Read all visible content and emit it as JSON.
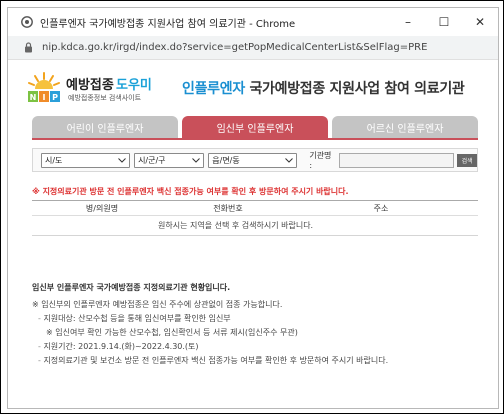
{
  "window": {
    "title": "인플루엔자 국가예방접종 지원사업 참여 의료기관 - Chrome",
    "url": "nip.kdca.go.kr/irgd/index.do?service=getPopMedicalCenterList&SelFlag=PRE",
    "minimize": "–",
    "maximize": "☐",
    "close": "✕"
  },
  "logo": {
    "brand_main": "예방접종",
    "brand_accent": "도우미",
    "sub": "예방접종정보 검색사이트",
    "letters": "NIP"
  },
  "header": {
    "title_accent": "인플루엔자",
    "title_rest": " 국가예방접종 지원사업 참여 의료기관"
  },
  "tabs": [
    {
      "label": "어린이 인플루엔자",
      "active": false
    },
    {
      "label": "임신부 인플루엔자",
      "active": true
    },
    {
      "label": "어르신 인플루엔자",
      "active": false
    }
  ],
  "filters": {
    "sido": "시/도",
    "sigungu": "시/군/구",
    "eupmyeondong": "읍/면/동",
    "org_label": "기관명 :",
    "org_value": "",
    "search_button": "검색"
  },
  "warning": "※ 지정의료기관 방문 전 인플루엔자 백신 접종가능 여부를 확인 후 방문하여 주시기 바랍니다.",
  "table": {
    "headers": [
      "병/의원명",
      "전화번호",
      "주소"
    ],
    "empty_message": "원하시는 지역을 선택 후 검색하시기 바랍니다."
  },
  "guide": {
    "title": "임신부 인플루엔자 국가예방접종 지정의료기관 현황입니다.",
    "lines": [
      "※ 임신부의 인플루엔자 예방접종은 임신 주수에 상관없이 접종 가능합니다.",
      "지원대상: 산모수첩 등을 통해 임신여부를 확인한 임신부",
      "※ 임신여부 확인 가능한 산모수첩, 임신확인서 등 서류 제시(임신주수 무관)",
      "지원기간: 2021.9.14.(화)~2022.4.30.(토)",
      "지정의료기관 및 보건소 방문 전 인플루엔자 백신 접종가능 여부를 확인한 후 방문하여 주시기 바랍니다."
    ],
    "bullet": "-"
  },
  "colors": {
    "accent_red": "#c9505a",
    "inactive_tab": "#c4c4c4",
    "title_blue": "#1a8fd1",
    "warning_red": "#dd3333"
  }
}
